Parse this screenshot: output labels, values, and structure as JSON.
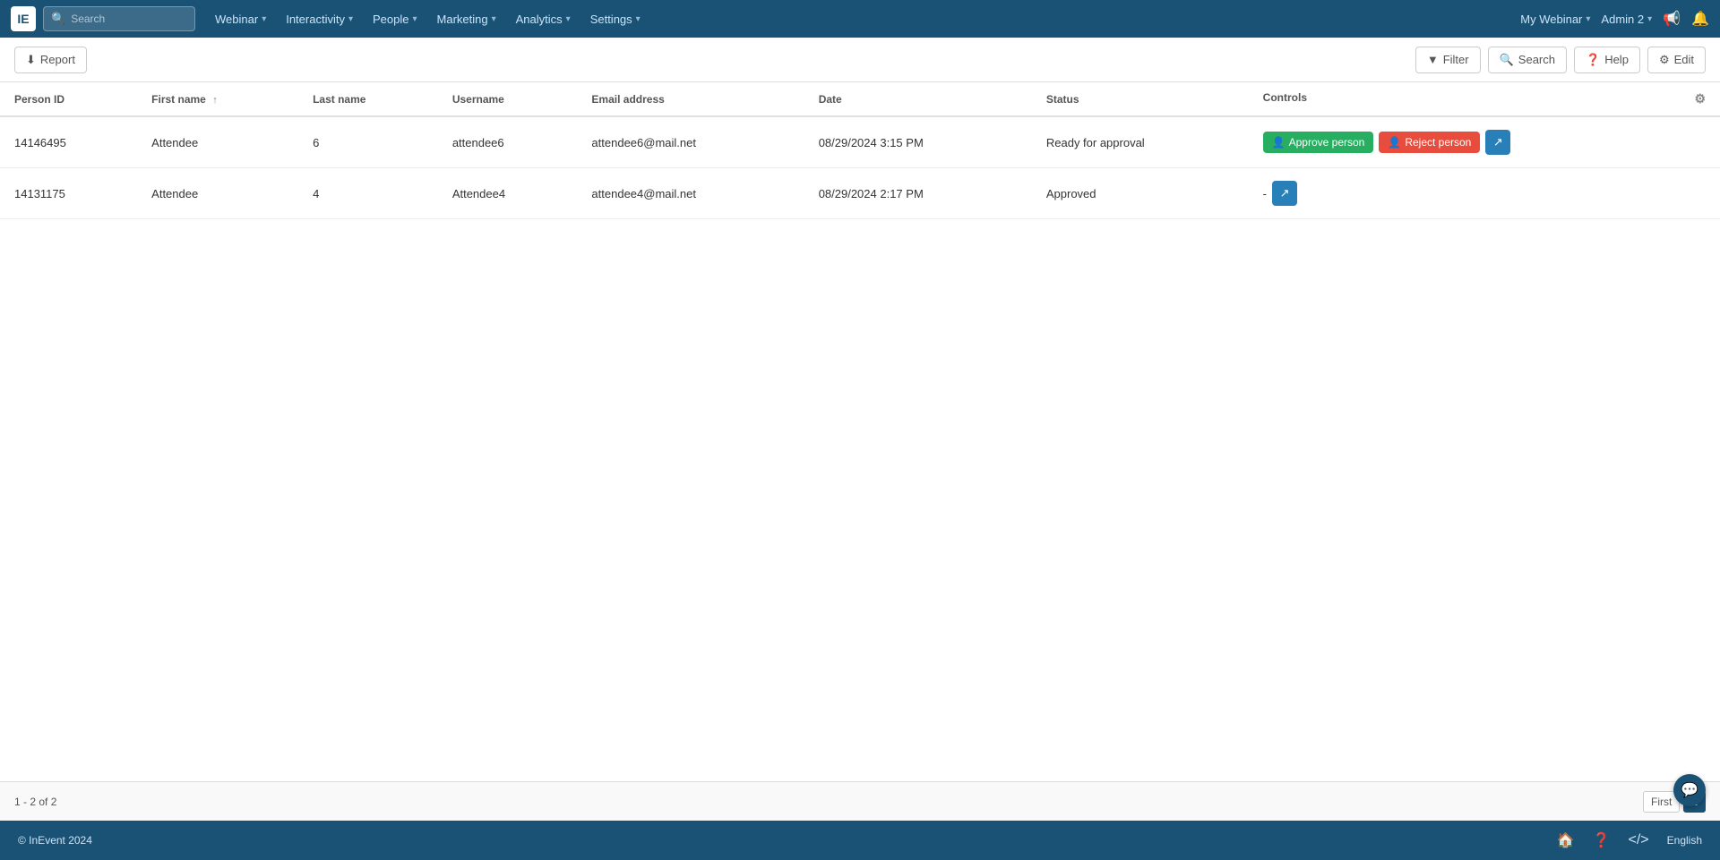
{
  "app": {
    "logo": "IE",
    "search_placeholder": "Search"
  },
  "nav": {
    "items": [
      {
        "label": "Webinar",
        "has_dropdown": true
      },
      {
        "label": "Interactivity",
        "has_dropdown": true
      },
      {
        "label": "People",
        "has_dropdown": true
      },
      {
        "label": "Marketing",
        "has_dropdown": true
      },
      {
        "label": "Analytics",
        "has_dropdown": true
      },
      {
        "label": "Settings",
        "has_dropdown": true
      }
    ],
    "right": {
      "webinar_name": "My Webinar",
      "admin_name": "Admin 2"
    }
  },
  "toolbar": {
    "report_label": "Report",
    "filter_label": "Filter",
    "search_label": "Search",
    "help_label": "Help",
    "edit_label": "Edit"
  },
  "table": {
    "columns": [
      {
        "key": "person_id",
        "label": "Person ID"
      },
      {
        "key": "first_name",
        "label": "First name",
        "sortable": true
      },
      {
        "key": "last_name",
        "label": "Last name"
      },
      {
        "key": "username",
        "label": "Username"
      },
      {
        "key": "email",
        "label": "Email address"
      },
      {
        "key": "date",
        "label": "Date"
      },
      {
        "key": "status",
        "label": "Status"
      },
      {
        "key": "controls",
        "label": "Controls"
      }
    ],
    "rows": [
      {
        "person_id": "14146495",
        "first_name": "Attendee",
        "last_name": "6",
        "username": "attendee6",
        "email": "attendee6@mail.net",
        "date": "08/29/2024 3:15 PM",
        "status": "Ready for approval",
        "has_approve": true,
        "has_reject": true,
        "approve_label": "Approve person",
        "reject_label": "Reject person"
      },
      {
        "person_id": "14131175",
        "first_name": "Attendee",
        "last_name": "4",
        "username": "Attendee4",
        "email": "attendee4@mail.net",
        "date": "08/29/2024 2:17 PM",
        "status": "Approved",
        "has_approve": false,
        "has_reject": false,
        "approve_label": "",
        "reject_label": "",
        "controls_dash": "-"
      }
    ]
  },
  "pagination": {
    "info": "1 - 2 of 2",
    "first_label": "First",
    "page_number": "1"
  },
  "footer": {
    "copyright": "© InEvent 2024",
    "language": "English"
  }
}
